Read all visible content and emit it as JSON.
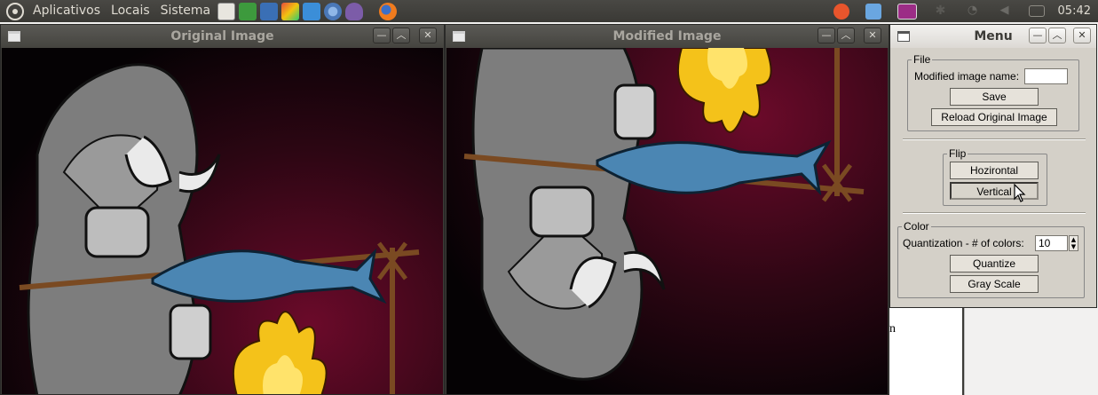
{
  "panel": {
    "menus": [
      "Aplicativos",
      "Locais",
      "Sistema"
    ],
    "launchers": [
      "text-editor-icon",
      "spreadsheet-icon",
      "document-icon",
      "paint-icon",
      "dropbox-icon",
      "chromium-icon",
      "pidgin-icon",
      "firefox-icon"
    ],
    "tray": [
      "ubuntuone-icon",
      "dropbox-icon",
      "terminal-icon",
      "bluetooth-icon",
      "wifi-icon",
      "volume-icon",
      "mail-icon"
    ],
    "clock": "05:42"
  },
  "original_window": {
    "title": "Original Image"
  },
  "modified_window": {
    "title": "Modified Image"
  },
  "menu_window": {
    "title": "Menu",
    "file": {
      "legend": "File",
      "name_label": "Modified image name:",
      "name_value": "",
      "save_label": "Save",
      "reload_label": "Reload Original Image"
    },
    "flip": {
      "legend": "Flip",
      "horizontal_label": "Hozirontal",
      "vertical_label": "Vertical"
    },
    "color": {
      "legend": "Color",
      "quant_label": "Quantization - # of colors:",
      "quant_value": "10",
      "quantize_label": "Quantize",
      "grayscale_label": "Gray Scale"
    }
  },
  "background_doc": {
    "fragment": "n"
  },
  "colors": {
    "panel": "#3c3b37",
    "menu_bg": "#d4d0c8",
    "accent_orange": "#f07746"
  }
}
